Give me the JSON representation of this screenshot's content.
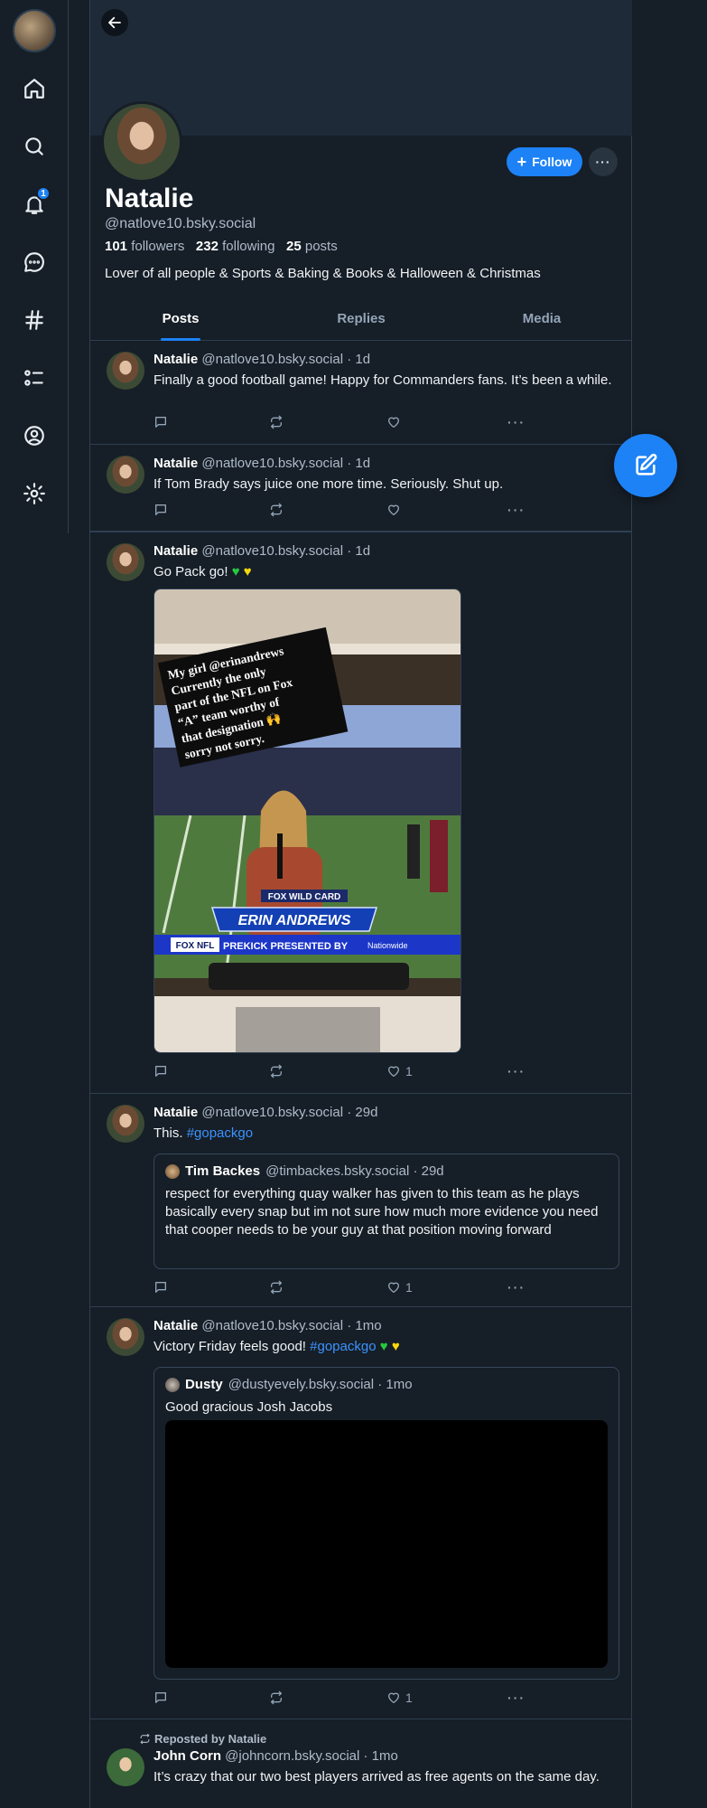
{
  "sidebar": {
    "notification_count": "1",
    "items": [
      {
        "icon": "home-icon"
      },
      {
        "icon": "search-icon"
      },
      {
        "icon": "bell-icon"
      },
      {
        "icon": "chat-icon"
      },
      {
        "icon": "hashtag-icon"
      },
      {
        "icon": "list-icon"
      },
      {
        "icon": "profile-icon"
      },
      {
        "icon": "settings-icon"
      }
    ]
  },
  "profile": {
    "name": "Natalie",
    "handle": "@natlove10.bsky.social",
    "followers_count": "101",
    "followers_label": "followers",
    "following_count": "232",
    "following_label": "following",
    "posts_count": "25",
    "posts_label": "posts",
    "bio": "Lover of all people & Sports & Baking & Books & Halloween & Christmas",
    "follow_label": "Follow",
    "more_label": "···"
  },
  "tabs": [
    "Posts",
    "Replies",
    "Media"
  ],
  "colors": {
    "accent": "#1d82f5",
    "background": "#161e27",
    "border": "#2e4052"
  },
  "posts": [
    {
      "author": "Natalie",
      "handle": "@natlove10.bsky.social · 1d",
      "text": "Finally a good football game! Happy for Commanders fans. It’s been a while.",
      "likes": ""
    },
    {
      "author": "Natalie",
      "handle": "@natlove10.bsky.social · 1d",
      "text": "If Tom Brady says juice one more time. Seriously. Shut up.",
      "likes": ""
    },
    {
      "author": "Natalie",
      "handle": "@natlove10.bsky.social · 1d",
      "text": "Go Pack go!",
      "likes": "1",
      "image": {
        "caption_lines": [
          "My girl @erinandrews",
          "Currently the only",
          "part of the NFL on Fox",
          "“A” team worthy of",
          "that designation 🙌",
          "sorry not sorry."
        ],
        "graphic_top": "FOX WILD CARD",
        "graphic_name": "ERIN ANDREWS",
        "ticker": "PREKICK PRESENTED BY",
        "ticker_brand": "FOX NFL",
        "sponsor": "Nationwide"
      }
    },
    {
      "author": "Natalie",
      "handle": "@natlove10.bsky.social · 29d",
      "text": "This.",
      "hashtag": "#gopackgo",
      "likes": "1",
      "quote": {
        "author": "Tim Backes",
        "handle": "@timbackes.bsky.social · 29d",
        "text": "respect for everything quay walker has given to this team as he plays basically every snap but im not sure how much more evidence you need that cooper needs to be your guy at that position moving forward"
      }
    },
    {
      "author": "Natalie",
      "handle": "@natlove10.bsky.social · 1mo",
      "text": "Victory Friday feels good!",
      "hashtag": "#gopackgo",
      "likes": "1",
      "quote": {
        "author": "Dusty",
        "handle": "@dustyevely.bsky.social · 1mo",
        "text": "Good gracious Josh Jacobs"
      }
    },
    {
      "repost_label": "Reposted by Natalie",
      "author": "John Corn",
      "handle": "@johncorn.bsky.social · 1mo",
      "text": "It’s crazy that our two best players arrived as free agents on the same day."
    }
  ]
}
